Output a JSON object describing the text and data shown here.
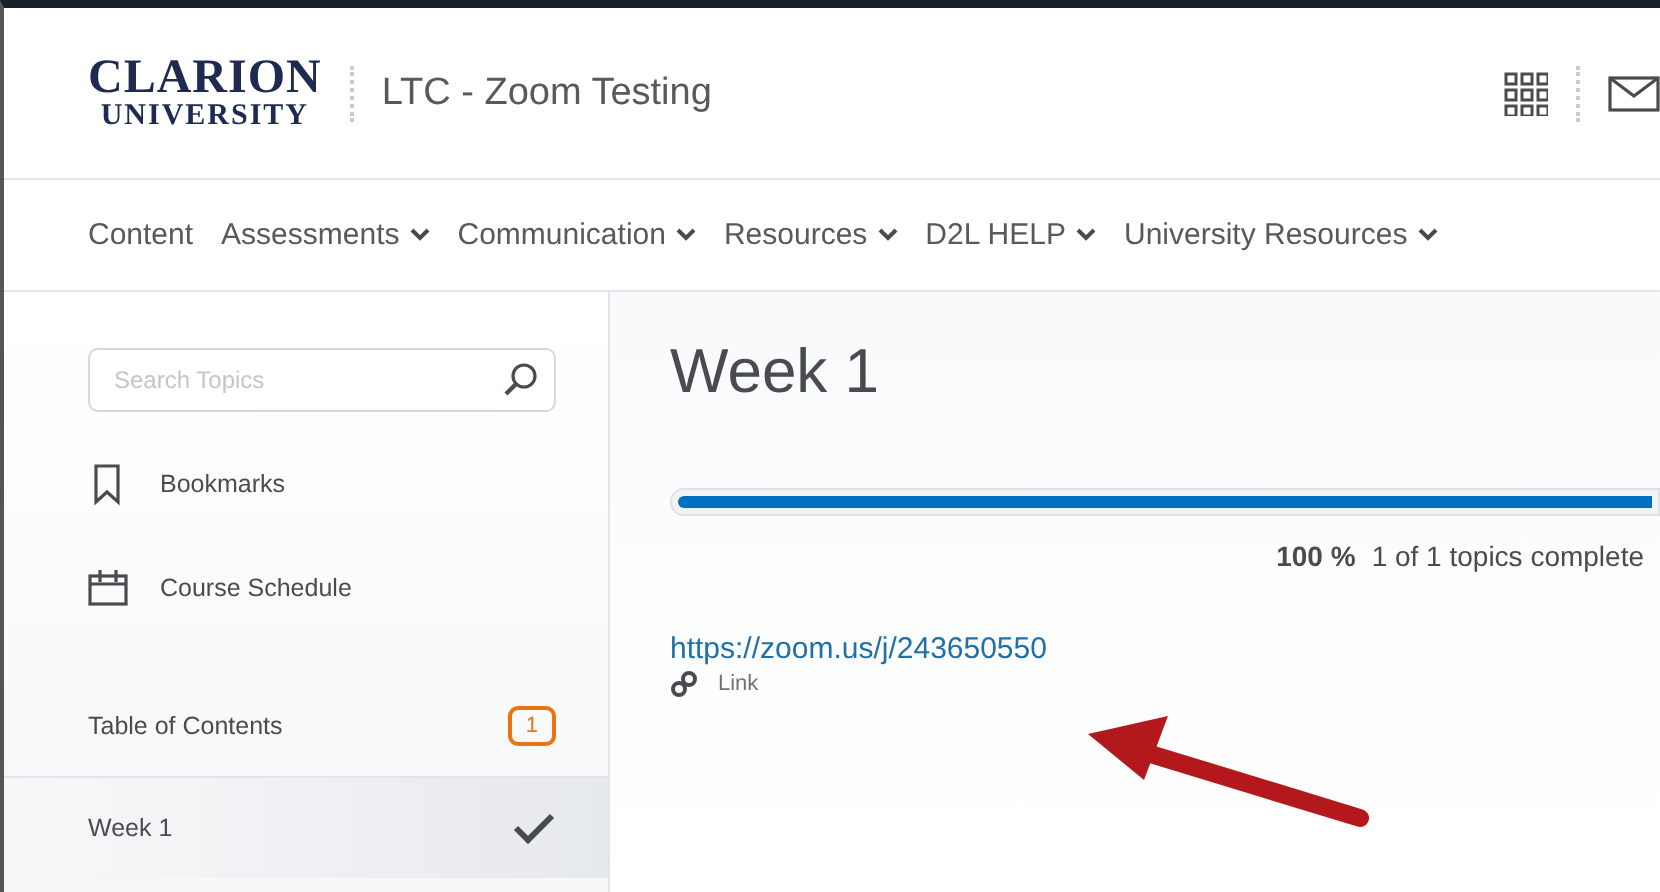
{
  "header": {
    "logo": [
      "CLARION",
      "UNIVERSITY"
    ],
    "course_title": "LTC - Zoom Testing"
  },
  "nav": [
    {
      "label": "Content",
      "has_menu": false
    },
    {
      "label": "Assessments",
      "has_menu": true
    },
    {
      "label": "Communication",
      "has_menu": true
    },
    {
      "label": "Resources",
      "has_menu": true
    },
    {
      "label": "D2L HELP",
      "has_menu": true
    },
    {
      "label": "University Resources",
      "has_menu": true
    }
  ],
  "sidebar": {
    "search": {
      "placeholder": "Search Topics"
    },
    "items": [
      {
        "label": "Bookmarks",
        "kind": "bookmark"
      },
      {
        "label": "Course Schedule",
        "kind": "calendar"
      }
    ],
    "toc": {
      "label": "Table of Contents",
      "badge": "1"
    },
    "modules": [
      {
        "label": "Week 1",
        "selected": true,
        "completed": true
      }
    ]
  },
  "main": {
    "title": "Week 1",
    "progress": {
      "level": 1,
      "percent": "100 %",
      "summary": "1 of 1 topics complete"
    },
    "topics": [
      {
        "url": "https://zoom.us/j/243650550",
        "type": "Link"
      }
    ]
  }
}
